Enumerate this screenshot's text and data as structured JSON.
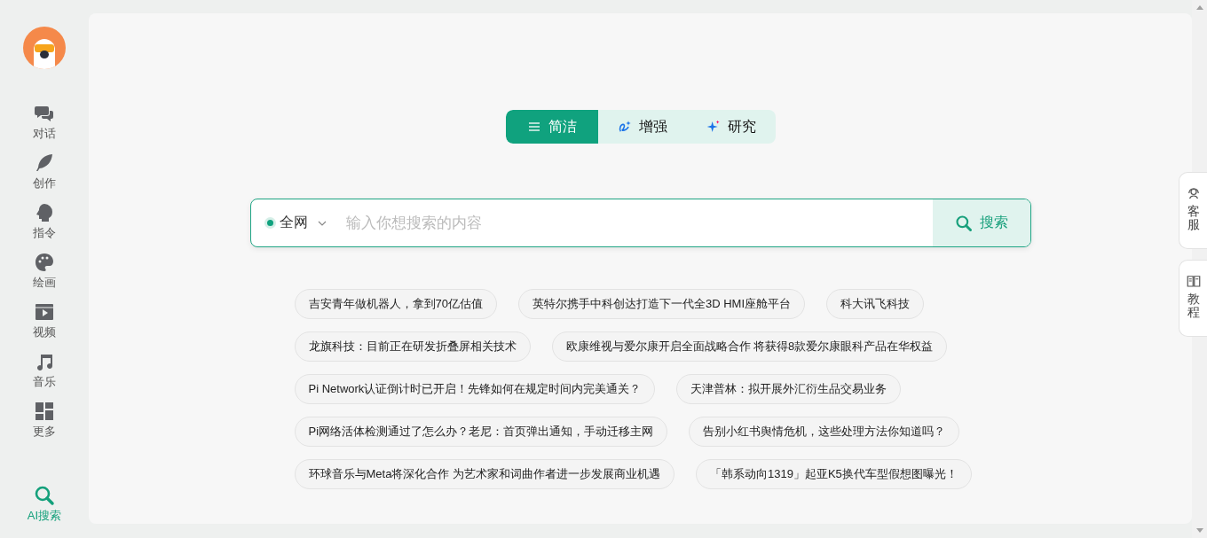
{
  "sidebar": {
    "items": [
      {
        "kind": "chat",
        "label": "对话",
        "selected": false
      },
      {
        "kind": "feather",
        "label": "创作",
        "selected": false
      },
      {
        "kind": "head",
        "label": "指令",
        "selected": false
      },
      {
        "kind": "palette",
        "label": "绘画",
        "selected": false
      },
      {
        "kind": "video",
        "label": "视频",
        "selected": false
      },
      {
        "kind": "music",
        "label": "音乐",
        "selected": false
      },
      {
        "kind": "grid",
        "label": "更多",
        "selected": false
      }
    ],
    "bottom_item": {
      "kind": "search",
      "label": "AI搜索",
      "selected": true
    }
  },
  "modes": [
    {
      "kind": "list",
      "label": "简洁",
      "selected": true
    },
    {
      "kind": "loop",
      "label": "增强",
      "selected": false
    },
    {
      "kind": "star",
      "label": "研究",
      "selected": false
    }
  ],
  "search": {
    "scope": "全网",
    "placeholder": "输入你想搜索的内容",
    "button": "搜索"
  },
  "suggestions": [
    [
      "吉安青年做机器人，拿到70亿估值",
      "英特尔携手中科创达打造下一代全3D HMI座舱平台",
      "科大讯飞科技"
    ],
    [
      "龙旗科技：目前正在研发折叠屏相关技术",
      "欧康维视与爱尔康开启全面战略合作 将获得8款爱尔康眼科产品在华权益"
    ],
    [
      "Pi Network认证倒计时已开启！先锋如何在规定时间内完美通关？",
      "天津普林：拟开展外汇衍生品交易业务"
    ],
    [
      "Pi网络活体检测通过了怎么办？老尼：首页弹出通知，手动迁移主网",
      "告别小红书舆情危机，这些处理方法你知道吗？"
    ],
    [
      "环球音乐与Meta将深化合作 为艺术家和词曲作者进一步发展商业机遇",
      "「韩系动向1319」起亚K5换代车型假想图曝光！"
    ]
  ],
  "float_buttons": [
    {
      "kind": "support",
      "label": "客服"
    },
    {
      "kind": "book",
      "label": "教程"
    }
  ]
}
